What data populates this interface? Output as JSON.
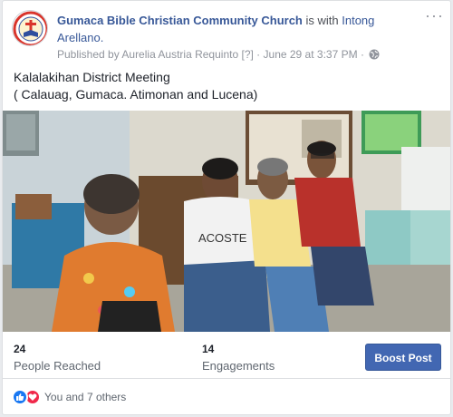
{
  "post": {
    "page_name": "Gumaca Bible Christian Community Church",
    "with_text": "is with",
    "tagged_name": "Intong Arellano.",
    "published_by": "Published by Aurelia Austria Requinto",
    "help_mark": "[?]",
    "separator": "·",
    "date": "June 29 at 3:37 PM",
    "separator2": "·",
    "more_label": "···",
    "text_line1": "Kalalakihan District Meeting",
    "text_line2": "( Calauag, Gumaca. Atimonan and Lucena)"
  },
  "photo": {
    "shirt_text": "ACOSTE"
  },
  "stats": {
    "reached_value": "24",
    "reached_label": "People Reached",
    "engagements_value": "14",
    "engagements_label": "Engagements",
    "boost_label": "Boost Post"
  },
  "reactions": {
    "summary": "You and 7 others",
    "icons": [
      "like-icon",
      "love-icon"
    ]
  },
  "colors": {
    "link": "#385898",
    "button": "#4267b2",
    "like": "#1877f2",
    "love": "#f0284a"
  }
}
